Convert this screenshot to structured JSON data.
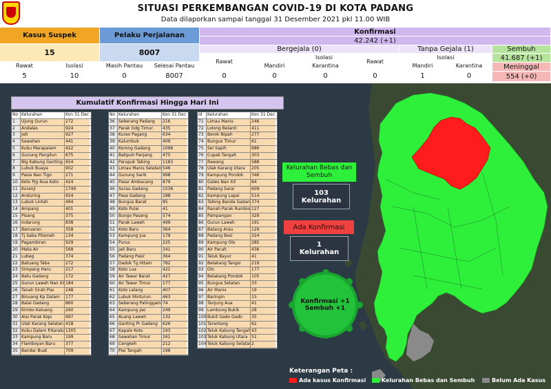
{
  "header": {
    "title": "SITUASI PERKEMBANGAN COVID-19 DI KOTA PADANG",
    "subtitle": "Data dilaporkan sampai tanggal 31 Desember 2021 pkl 11.00 WIB"
  },
  "stats": {
    "suspek": {
      "label": "Kasus Suspek",
      "value": "15",
      "rawat_label": "Rawat",
      "rawat": "5",
      "isolasi_label": "Isolasi",
      "isolasi": "10"
    },
    "pelaku": {
      "label": "Pelaku Perjalanan",
      "value": "8007",
      "masih_label": "Masih Pantau",
      "masih": "0",
      "selesai_label": "Selesai Pantau",
      "selesai": "8007"
    },
    "konfirmasi": {
      "label": "Konfirmasi",
      "value": "42.242 (+1)"
    },
    "bergejala": {
      "label": "Bergejala (0)",
      "rawat_label": "Rawat",
      "rawat": "0",
      "isolasi_label": "Isolasi",
      "mandiri_label": "Mandiri",
      "mandiri": "0",
      "karantina_label": "Karantina",
      "karantina": "0"
    },
    "tanpa_gejala": {
      "label": "Tanpa Gejala (1)",
      "rawat_label": "Rawat",
      "rawat": "0",
      "isolasi_label": "Isolasi",
      "mandiri_label": "Mandiri",
      "mandiri": "1",
      "karantina_label": "Karantina",
      "karantina": "0"
    },
    "sembuh": {
      "label": "Sembuh",
      "value": "41.687 (+1)"
    },
    "meninggal": {
      "label": "Meninggal",
      "value": "554 (+0)"
    }
  },
  "table": {
    "title": "Kumulatif Konfirmasi Hingga Hari Ini",
    "hdr_no": "No",
    "hdr_no3": "Id",
    "hdr_kel": "Kelurahan",
    "hdr_val": "Kon 31 Dec",
    "rows1": [
      [
        "1",
        "Ujung Gurun",
        "272"
      ],
      [
        "2",
        "Andalas",
        "924"
      ],
      [
        "3",
        "Jati",
        "927"
      ],
      [
        "4",
        "Sawahan",
        "441"
      ],
      [
        "5",
        "Kubu Marapalam",
        "422"
      ],
      [
        "6",
        "Gunung Pangilun",
        "675"
      ],
      [
        "7",
        "Blg Kabung Ganting",
        "654"
      ],
      [
        "8",
        "Lubuk Buaya",
        "902"
      ],
      [
        "9",
        "Pasie Nan Tigo",
        "271"
      ],
      [
        "10",
        "Koto Pjg Ikua Koto",
        "424"
      ],
      [
        "11",
        "Kuranji",
        "1749"
      ],
      [
        "12",
        "Anduring",
        "654"
      ],
      [
        "13",
        "Lubuk Lintah",
        "494"
      ],
      [
        "14",
        "Ampang",
        "401"
      ],
      [
        "15",
        "Pisang",
        "375"
      ],
      [
        "16",
        "Indarung",
        "838"
      ],
      [
        "17",
        "Banuaran",
        "358"
      ],
      [
        "18",
        "Tj Saba Pitameh",
        "134"
      ],
      [
        "19",
        "Pagambiran",
        "929"
      ],
      [
        "20",
        "Mata Air",
        "568"
      ],
      [
        "21",
        "Lubeg",
        "374"
      ],
      [
        "22",
        "Batuang Taba",
        "272"
      ],
      [
        "23",
        "Simpang Haru",
        "217"
      ],
      [
        "24",
        "Batu Gadang",
        "172"
      ],
      [
        "25",
        "Gurun Laweh Nan XX",
        "184"
      ],
      [
        "26",
        "Tanah Sirah Piai",
        "248"
      ],
      [
        "27",
        "Binuang Kp Dalam",
        "177"
      ],
      [
        "28",
        "Balai Gadang",
        "860"
      ],
      [
        "29",
        "Kimbo Kaluang",
        "260"
      ],
      [
        "30",
        "Alai Parak Kopi",
        "997"
      ],
      [
        "31",
        "Ulak Karang Selatan",
        "418"
      ],
      [
        "32",
        "Kubu Dalam P.Karakah",
        "1305"
      ],
      [
        "33",
        "Kampung Baru",
        "199"
      ],
      [
        "34",
        "Flamboyan Baru",
        "377"
      ],
      [
        "35",
        "Bandar Buat",
        "709"
      ]
    ],
    "rows2": [
      [
        "36",
        "Seberang Padang",
        "216"
      ],
      [
        "37",
        "Parak Gdg Timur",
        "435"
      ],
      [
        "38",
        "Kurao Pagang",
        "634"
      ],
      [
        "39",
        "Kalumbuk",
        "409"
      ],
      [
        "40",
        "Korong Gadang",
        "1096"
      ],
      [
        "41",
        "Batipuh Panjang",
        "475"
      ],
      [
        "42",
        "Parupuk Tabing",
        "1183"
      ],
      [
        "43",
        "Limau Manis Selatan",
        "546"
      ],
      [
        "44",
        "Gunung Sarik",
        "998"
      ],
      [
        "45",
        "Pasar Ambacang",
        "879"
      ],
      [
        "46",
        "Surau Gadang",
        "1536"
      ],
      [
        "47",
        "Pasa Gadang",
        "188"
      ],
      [
        "48",
        "Bungus Barat",
        "85"
      ],
      [
        "49",
        "Koto Pulai",
        "41"
      ],
      [
        "50",
        "Bungo Pasang",
        "574"
      ],
      [
        "51",
        "Parak Laweh",
        "499"
      ],
      [
        "52",
        "Koto Baru",
        "364"
      ],
      [
        "53",
        "Kampung Jua",
        "179"
      ],
      [
        "54",
        "Purus",
        "225"
      ],
      [
        "55",
        "Jati Baru",
        "341"
      ],
      [
        "56",
        "Padang Pasir",
        "364"
      ],
      [
        "57",
        "Dadok Tg Hitam",
        "782"
      ],
      [
        "58",
        "Koto Lua",
        "421"
      ],
      [
        "59",
        "Air Tawar Barat",
        "427"
      ],
      [
        "60",
        "Air Tawar Timur",
        "177"
      ],
      [
        "61",
        "Koto Lalang",
        "407"
      ],
      [
        "62",
        "Lubuk Minturun",
        "463"
      ],
      [
        "63",
        "Seberang Palinggam",
        "74"
      ],
      [
        "64",
        "Kampung Jao",
        "249"
      ],
      [
        "65",
        "ALang Laweh",
        "132"
      ],
      [
        "66",
        "Ganting Pr Gadang",
        "626"
      ],
      [
        "67",
        "Kapalo Koto",
        "193"
      ],
      [
        "68",
        "Sawahan Timur",
        "261"
      ],
      [
        "69",
        "Cengkeh",
        "212"
      ],
      [
        "70",
        "Piai Tangah",
        "198"
      ]
    ],
    "rows3": [
      [
        "71",
        "Limau Manis",
        "246"
      ],
      [
        "72",
        "Lolong Belanti",
        "411"
      ],
      [
        "73",
        "Berok Nipah",
        "277"
      ],
      [
        "74",
        "Bungus Timur",
        "61"
      ],
      [
        "75",
        "Sei Sapih",
        "686"
      ],
      [
        "76",
        "Cupak Tangah",
        "303"
      ],
      [
        "77",
        "Rawang",
        "588"
      ],
      [
        "78",
        "Ulak Karang Utara",
        "205"
      ],
      [
        "79",
        "Kampung Pondok",
        "346"
      ],
      [
        "80",
        "Gates Nan XX",
        "84"
      ],
      [
        "81",
        "Padang Sarai",
        "609"
      ],
      [
        "82",
        "Kampung Lapai",
        "514"
      ],
      [
        "83",
        "Tabing Banda Gadang",
        "374"
      ],
      [
        "84",
        "Ranah Parak Rumbio",
        "127"
      ],
      [
        "85",
        "Pampangan",
        "329"
      ],
      [
        "86",
        "Gurun Laweh",
        "191"
      ],
      [
        "87",
        "Batang Arau",
        "129"
      ],
      [
        "88",
        "Padang Besi",
        "324"
      ],
      [
        "89",
        "Kampung Olo",
        "285"
      ],
      [
        "90",
        "Air Pacah",
        "436"
      ],
      [
        "91",
        "Teluk Bayur",
        "41"
      ],
      [
        "92",
        "Belakang Tangsi",
        "219"
      ],
      [
        "93",
        "Olo",
        "177"
      ],
      [
        "94",
        "Belakang Pondok",
        "105"
      ],
      [
        "95",
        "Bungus Selatan",
        "33"
      ],
      [
        "96",
        "Air Manis",
        "19"
      ],
      [
        "97",
        "Baringin",
        "15"
      ],
      [
        "98",
        "Tanjung Aua",
        "41"
      ],
      [
        "99",
        "Lambung Bukik",
        "28"
      ],
      [
        "100",
        "Bukit Gado Gado",
        "35"
      ],
      [
        "101",
        "Tarantang",
        "62"
      ],
      [
        "102",
        "Teluk Kabung Tengah",
        "43"
      ],
      [
        "103",
        "Teluk Kabung Utara",
        "51"
      ],
      [
        "104",
        "Teluk Kabung Selatan",
        "2"
      ]
    ]
  },
  "map": {
    "bebas_label": "Kelurahan Bebas dan Sembuh",
    "bebas_value": "103",
    "bebas_unit": "Kelurahan",
    "ada_label": "Ada Konfirmasi",
    "ada_value": "1",
    "ada_unit": "Kelurahan",
    "virus_line1": "Konfirmasi +1",
    "virus_line2": "Sembuh +1",
    "legend_title": "Keterangan Peta :",
    "legend": [
      "Ada kasus Konfirmasi",
      "Kelurahan Bebas dan Sembuh",
      "Belum Ada Kasus"
    ],
    "colors": {
      "red": "#ff1c1c",
      "green": "#2ef03a",
      "gray": "#8a8a8a"
    }
  }
}
